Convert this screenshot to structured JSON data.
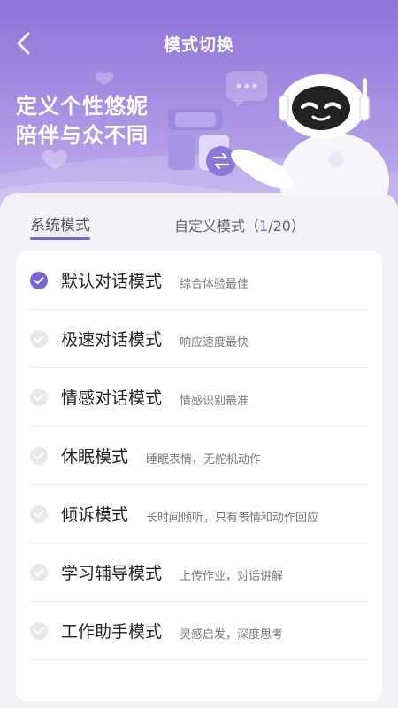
{
  "header": {
    "title": "模式切换",
    "back_icon": "chevron-left-icon"
  },
  "banner": {
    "slogan_line1": "定义个性悠妮",
    "slogan_line2": "陪伴与众不同",
    "colors": {
      "top": "#8d74d8",
      "bottom": "#c4b6ee"
    }
  },
  "tabs": {
    "system_label": "系统模式",
    "custom_label": "自定义模式",
    "custom_open": "（",
    "custom_count": "1",
    "custom_sep": "/",
    "custom_total": "20",
    "custom_close": "）"
  },
  "modes": [
    {
      "name": "默认对话模式",
      "desc": "综合体验最佳",
      "selected": true
    },
    {
      "name": "极速对话模式",
      "desc": "响应速度最快",
      "selected": false
    },
    {
      "name": "情感对话模式",
      "desc": "情感识别最准",
      "selected": false
    },
    {
      "name": "休眠模式",
      "desc": "睡眠表情，无舵机动作",
      "selected": false
    },
    {
      "name": "倾诉模式",
      "desc": "长时间倾听，只有表情和动作回应",
      "selected": false
    },
    {
      "name": "学习辅导模式",
      "desc": "上传作业，对话讲解",
      "selected": false
    },
    {
      "name": "工作助手模式",
      "desc": "灵感启发，深度思考",
      "selected": false
    }
  ],
  "theme": {
    "accent": "#7b64d0",
    "background": "#f3f2f7"
  }
}
